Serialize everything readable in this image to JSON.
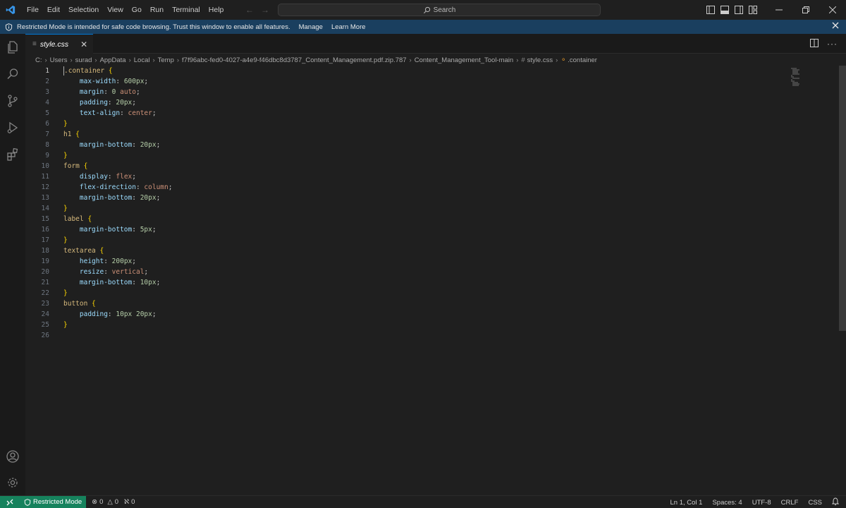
{
  "menu": [
    "File",
    "Edit",
    "Selection",
    "View",
    "Go",
    "Run",
    "Terminal",
    "Help"
  ],
  "search_label": "Search",
  "banner": {
    "message": "Restricted Mode is intended for safe code browsing. Trust this window to enable all features.",
    "manage": "Manage",
    "learn_more": "Learn More"
  },
  "tab": {
    "label": "style.css"
  },
  "breadcrumb": [
    "C:",
    "Users",
    "surad",
    "AppData",
    "Local",
    "Temp",
    "f7f96abc-fed0-4027-a4e9-f46dbc8d3787_Content_Management.pdf.zip.787",
    "Content_Management_Tool-main",
    "style.css",
    ".container"
  ],
  "code_lines": [
    {
      "n": "1",
      "parts": [
        [
          "sel",
          ".container "
        ],
        [
          "brace",
          "{"
        ]
      ]
    },
    {
      "n": "2",
      "parts": [
        [
          "prop",
          "    max-width"
        ],
        [
          "punc",
          ": "
        ],
        [
          "num",
          "600px"
        ],
        [
          "punc",
          ";"
        ]
      ]
    },
    {
      "n": "3",
      "parts": [
        [
          "prop",
          "    margin"
        ],
        [
          "punc",
          ": "
        ],
        [
          "num",
          "0"
        ],
        [
          "val",
          " auto"
        ],
        [
          "punc",
          ";"
        ]
      ]
    },
    {
      "n": "4",
      "parts": [
        [
          "prop",
          "    padding"
        ],
        [
          "punc",
          ": "
        ],
        [
          "num",
          "20px"
        ],
        [
          "punc",
          ";"
        ]
      ]
    },
    {
      "n": "5",
      "parts": [
        [
          "prop",
          "    text-align"
        ],
        [
          "punc",
          ": "
        ],
        [
          "val",
          "center"
        ],
        [
          "punc",
          ";"
        ]
      ]
    },
    {
      "n": "6",
      "parts": [
        [
          "brace",
          "}"
        ]
      ]
    },
    {
      "n": "7",
      "parts": [
        [
          "sel",
          "h1 "
        ],
        [
          "brace",
          "{"
        ]
      ]
    },
    {
      "n": "8",
      "parts": [
        [
          "prop",
          "    margin-bottom"
        ],
        [
          "punc",
          ": "
        ],
        [
          "num",
          "20px"
        ],
        [
          "punc",
          ";"
        ]
      ]
    },
    {
      "n": "9",
      "parts": [
        [
          "brace",
          "}"
        ]
      ]
    },
    {
      "n": "10",
      "parts": [
        [
          "sel",
          "form "
        ],
        [
          "brace",
          "{"
        ]
      ]
    },
    {
      "n": "11",
      "parts": [
        [
          "prop",
          "    display"
        ],
        [
          "punc",
          ": "
        ],
        [
          "val",
          "flex"
        ],
        [
          "punc",
          ";"
        ]
      ]
    },
    {
      "n": "12",
      "parts": [
        [
          "prop",
          "    flex-direction"
        ],
        [
          "punc",
          ": "
        ],
        [
          "val",
          "column"
        ],
        [
          "punc",
          ";"
        ]
      ]
    },
    {
      "n": "13",
      "parts": [
        [
          "prop",
          "    margin-bottom"
        ],
        [
          "punc",
          ": "
        ],
        [
          "num",
          "20px"
        ],
        [
          "punc",
          ";"
        ]
      ]
    },
    {
      "n": "14",
      "parts": [
        [
          "brace",
          "}"
        ]
      ]
    },
    {
      "n": "15",
      "parts": [
        [
          "sel",
          "label "
        ],
        [
          "brace",
          "{"
        ]
      ]
    },
    {
      "n": "16",
      "parts": [
        [
          "prop",
          "    margin-bottom"
        ],
        [
          "punc",
          ": "
        ],
        [
          "num",
          "5px"
        ],
        [
          "punc",
          ";"
        ]
      ]
    },
    {
      "n": "17",
      "parts": [
        [
          "brace",
          "}"
        ]
      ]
    },
    {
      "n": "18",
      "parts": [
        [
          "sel",
          "textarea "
        ],
        [
          "brace",
          "{"
        ]
      ]
    },
    {
      "n": "19",
      "parts": [
        [
          "prop",
          "    height"
        ],
        [
          "punc",
          ": "
        ],
        [
          "num",
          "200px"
        ],
        [
          "punc",
          ";"
        ]
      ]
    },
    {
      "n": "20",
      "parts": [
        [
          "prop",
          "    resize"
        ],
        [
          "punc",
          ": "
        ],
        [
          "val",
          "vertical"
        ],
        [
          "punc",
          ";"
        ]
      ]
    },
    {
      "n": "21",
      "parts": [
        [
          "prop",
          "    margin-bottom"
        ],
        [
          "punc",
          ": "
        ],
        [
          "num",
          "10px"
        ],
        [
          "punc",
          ";"
        ]
      ]
    },
    {
      "n": "22",
      "parts": [
        [
          "brace",
          "}"
        ]
      ]
    },
    {
      "n": "23",
      "parts": [
        [
          "sel",
          "button "
        ],
        [
          "brace",
          "{"
        ]
      ]
    },
    {
      "n": "24",
      "parts": [
        [
          "prop",
          "    padding"
        ],
        [
          "punc",
          ": "
        ],
        [
          "num",
          "10px 20px"
        ],
        [
          "punc",
          ";"
        ]
      ]
    },
    {
      "n": "25",
      "parts": [
        [
          "brace",
          "}"
        ]
      ]
    },
    {
      "n": "26",
      "parts": []
    }
  ],
  "status": {
    "restricted": "Restricted Mode",
    "errors": "0",
    "warnings": "0",
    "ports": "0",
    "position": "Ln 1, Col 1",
    "spaces": "Spaces: 4",
    "encoding": "UTF-8",
    "eol": "CRLF",
    "language": "CSS"
  },
  "colors": {
    "accent": "#0078d4",
    "banner": "#1a3f5f",
    "restricted": "#16825d"
  }
}
